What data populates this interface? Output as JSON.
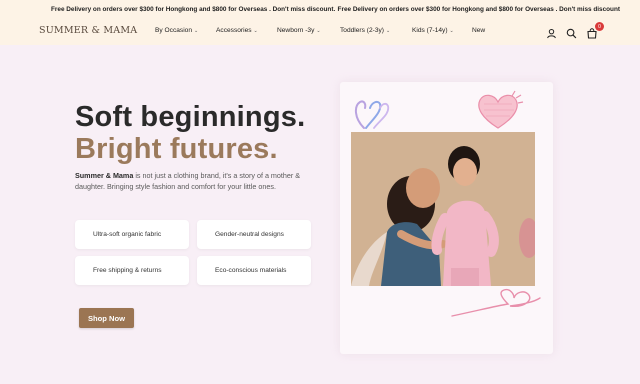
{
  "announcement": {
    "text_left": "Free Delivery on orders over $300 for Hongkong and $800 for Overseas . Don't miss discount.",
    "text_right": "Free Delivery on orders over $300 for Hongkong and $800 for Overseas . Don't miss discount"
  },
  "header": {
    "logo": "SUMMER & MAMA",
    "nav": [
      {
        "label": "By Occasion",
        "has_dropdown": true
      },
      {
        "label": "Accessories",
        "has_dropdown": true
      },
      {
        "label": "Newborn -3y",
        "has_dropdown": true
      },
      {
        "label": "Toddlers (2-3y)",
        "has_dropdown": true
      },
      {
        "label": "Kids (7-14y)",
        "has_dropdown": true
      },
      {
        "label": "New",
        "has_dropdown": false
      }
    ],
    "icons": [
      "user-icon",
      "search-icon",
      "cart-icon"
    ],
    "cart_count": "0"
  },
  "hero": {
    "title_line1": "Soft beginnings.",
    "title_line2": "Bright futures.",
    "desc_brand": "Summer & Mama",
    "desc_rest": " is not just a clothing brand, it's a story of a mother & daughter. Bringing style fashion and comfort for your little ones.",
    "features": [
      "Ultra-soft organic fabric",
      "Gender-neutral designs",
      "Free shipping & returns",
      "Eco-conscious materials"
    ],
    "cta": "Shop Now"
  },
  "colors": {
    "background": "#f8eff6",
    "topbar": "#fdf3e6",
    "accent_brown": "#9b7a5c",
    "button": "#9b7553",
    "badge": "#d93a3a",
    "doodle_pink": "#e88fab",
    "doodle_purple": "#b9a3e0"
  }
}
